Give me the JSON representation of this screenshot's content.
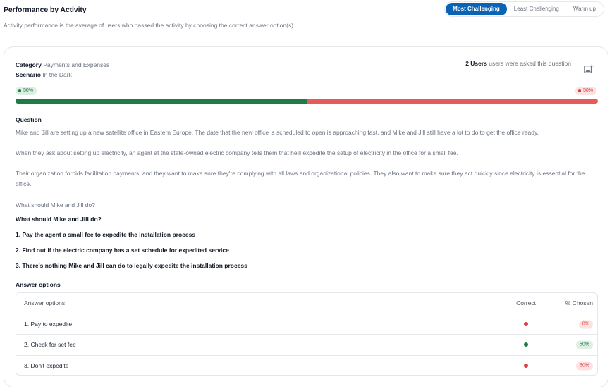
{
  "header": {
    "title": "Performance by Activity",
    "subtitle": "Activity performance is the average of users who passed the activity by choosing the correct answer option(s).",
    "tabs": [
      {
        "label": "Most Challenging",
        "active": true
      },
      {
        "label": "Least Challenging",
        "active": false
      },
      {
        "label": "Warm up",
        "active": false
      }
    ]
  },
  "card": {
    "category_label": "Category",
    "category_value": "Payments and Expenses",
    "scenario_label": "Scenario",
    "scenario_value": "In the Dark",
    "users_count": "2 Users",
    "users_text": "users were asked this question",
    "correct_pill": "50%",
    "incorrect_pill": "50%",
    "progress": {
      "correct_fraction": 0.5,
      "correct_color": "#1e7a46",
      "incorrect_color": "#e85a5a"
    },
    "question_heading": "Question",
    "paragraphs": [
      "Mike and Jill are setting up a new satellite office in Eastern Europe. The date that the new office is scheduled to open is approaching fast, and Mike and Jill still have a lot to do to get the office ready.",
      "When they ask about setting up electricity, an agent at the state-owned electric company tells them that he'll expedite the setup of electricity in the office for a small fee.",
      "Their organization forbids facilitation payments, and they want to make sure they're complying with all laws and organizational policies. They also want to make sure they act quickly since electricity is essential for the office.",
      "What should Mike and Jill do?"
    ],
    "prompt_bold": "What should Mike and Jill do?",
    "choices": [
      "1. Pay the agent a small fee to expedite the installation process",
      "2. Find out if the electric company has a set schedule for expedited service",
      "3. There's nothing Mike and Jill can do to legally expedite the installation process"
    ],
    "answers_heading": "Answer options",
    "table": {
      "headers": [
        "Answer options",
        "Correct",
        "% Chosen"
      ],
      "rows": [
        {
          "option": "1. Pay to expedite",
          "correct": false,
          "chosen": "0%"
        },
        {
          "option": "2. Check for set fee",
          "correct": true,
          "chosen": "50%"
        },
        {
          "option": "3. Don't expedite",
          "correct": false,
          "chosen": "50%"
        }
      ]
    }
  }
}
